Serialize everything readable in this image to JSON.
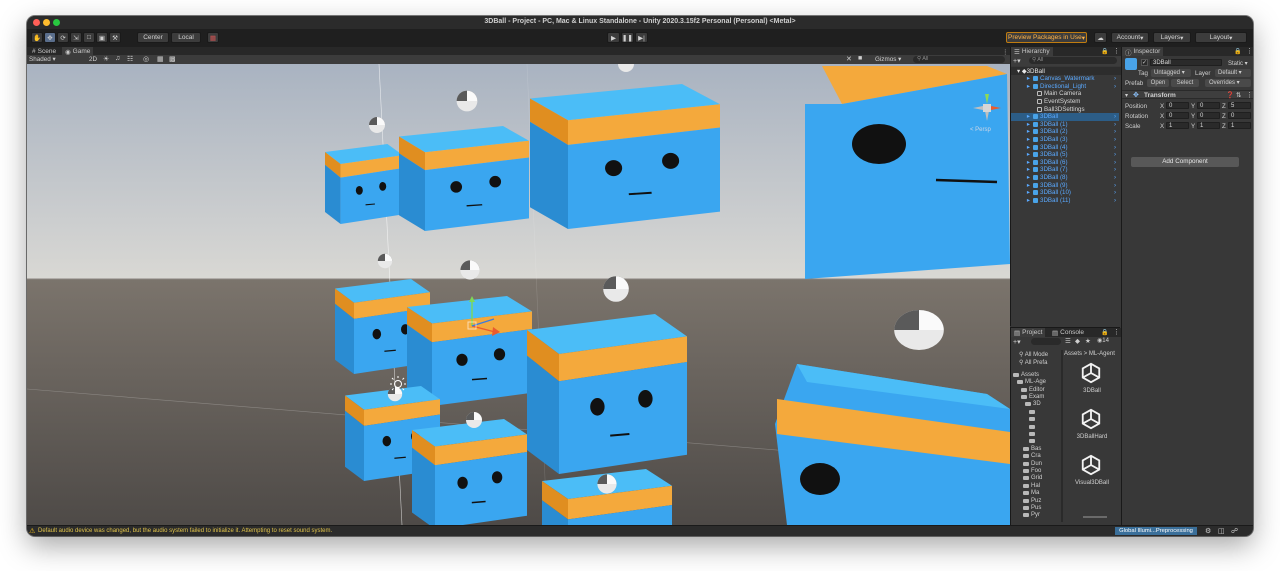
{
  "window": {
    "title": "3DBall - Project - PC, Mac & Linux Standalone - Unity 2020.3.15f2 Personal (Personal) <Metal>"
  },
  "toolbar": {
    "pivot_label": "Center",
    "space_label": "Local",
    "preview_packages": "Preview Packages in Use",
    "account": "Account",
    "layers": "Layers",
    "layout": "Layout"
  },
  "tabs": {
    "scene": "Scene",
    "game": "Game"
  },
  "gamebar": {
    "shading": "Shaded",
    "mode_2d": "2D",
    "gizmos": "Gizmos",
    "search_placeholder": "All"
  },
  "scene_gizmo": {
    "persp_label": "< Persp"
  },
  "hierarchy": {
    "tab": "Hierarchy",
    "search_placeholder": "All",
    "scene_name": "3DBall",
    "items": [
      {
        "label": "Canvas_Watermark",
        "blue": true,
        "selected": false
      },
      {
        "label": "Directional_Light",
        "blue": true,
        "selected": false
      },
      {
        "label": "Main Camera",
        "blue": false,
        "selected": false
      },
      {
        "label": "EventSystem",
        "blue": false,
        "selected": false
      },
      {
        "label": "Ball3DSettings",
        "blue": false,
        "selected": false
      },
      {
        "label": "3DBall",
        "blue": true,
        "selected": true
      },
      {
        "label": "3DBall (1)",
        "blue": true,
        "selected": false
      },
      {
        "label": "3DBall (2)",
        "blue": true,
        "selected": false
      },
      {
        "label": "3DBall (3)",
        "blue": true,
        "selected": false
      },
      {
        "label": "3DBall (4)",
        "blue": true,
        "selected": false
      },
      {
        "label": "3DBall (5)",
        "blue": true,
        "selected": false
      },
      {
        "label": "3DBall (6)",
        "blue": true,
        "selected": false
      },
      {
        "label": "3DBall (7)",
        "blue": true,
        "selected": false
      },
      {
        "label": "3DBall (8)",
        "blue": true,
        "selected": false
      },
      {
        "label": "3DBall (9)",
        "blue": true,
        "selected": false
      },
      {
        "label": "3DBall (10)",
        "blue": true,
        "selected": false
      },
      {
        "label": "3DBall (11)",
        "blue": true,
        "selected": false
      }
    ]
  },
  "inspector": {
    "tab": "Inspector",
    "object_name": "3DBall",
    "static_label": "Static",
    "tag_label": "Tag",
    "tag_value": "Untagged",
    "layer_label": "Layer",
    "layer_value": "Default",
    "prefab_label": "Prefab",
    "prefab_open": "Open",
    "prefab_select": "Select",
    "prefab_overrides": "Overrides",
    "transform_title": "Transform",
    "rows": [
      {
        "label": "Position",
        "x": "0",
        "y": "0",
        "z": "5"
      },
      {
        "label": "Rotation",
        "x": "0",
        "y": "0",
        "z": "0"
      },
      {
        "label": "Scale",
        "x": "1",
        "y": "1",
        "z": "1"
      }
    ],
    "add_component": "Add Component"
  },
  "project": {
    "tab_project": "Project",
    "tab_console": "Console",
    "count_badge": "14",
    "filter_all_models": "All Mode",
    "filter_all_prefabs": "All Prefa",
    "breadcrumb": "Assets > ML-Agent",
    "tree": [
      "Assets",
      "ML-Age",
      "Editor",
      "Exam",
      "3D",
      "",
      "",
      "",
      "",
      "",
      "Bas",
      "Cra",
      "Dun",
      "Foo",
      "Grid",
      "Hal",
      "Ma",
      "Puz",
      "Pus",
      "Pyr"
    ],
    "assets": [
      "3DBall",
      "3DBallHard",
      "Visual3DBall"
    ]
  },
  "status": {
    "warning": "Default audio device was changed, but the audio system failed to initialize it. Attempting to reset sound system.",
    "progress": "Global Illumi...Preprocessing"
  },
  "colors": {
    "cube_blue": "#3aa6f0",
    "cube_top": "#4bbdf7",
    "band_orange": "#f4a93c",
    "sky": "#c9ced6",
    "ground": "#5e5955",
    "selection": "#2c5d87",
    "link_blue": "#5aa9ff"
  }
}
